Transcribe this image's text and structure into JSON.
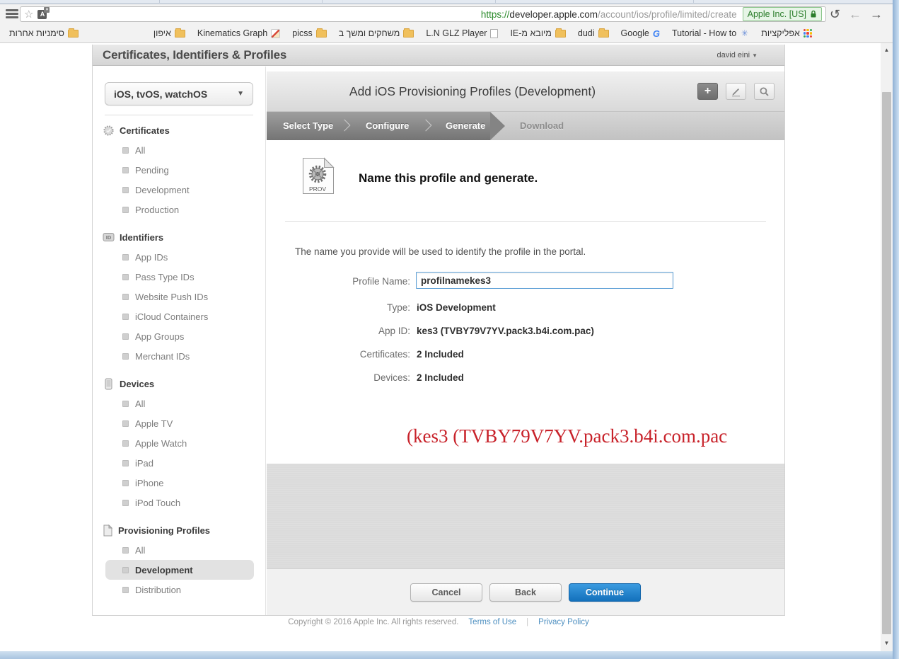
{
  "browser": {
    "toolbar": {
      "url": {
        "scheme": "https://",
        "host": "developer.apple.com",
        "path": "account/ios/profile/limited/create"
      },
      "security_badge": "Apple Inc. [US]"
    },
    "bookmarks_bar": {
      "items": [
        {
          "label": "סימניות אחרות",
          "icon": "folder-icon"
        },
        {
          "label": "איפון",
          "icon": "folder-icon"
        },
        {
          "label": "Kinematics Graph",
          "icon": "kinematics-favicon"
        },
        {
          "label": "picss",
          "icon": "folder-icon"
        },
        {
          "label": "משחקים ומשך ב",
          "icon": "folder-icon"
        },
        {
          "label": "L.N GLZ Player",
          "icon": "page-icon"
        },
        {
          "label": "מיובא מ-IE",
          "icon": "folder-icon"
        },
        {
          "label": "dudi",
          "icon": "folder-icon"
        },
        {
          "label": "Google",
          "icon": "google-favicon"
        },
        {
          "label": "Tutorial - How to",
          "icon": "asterisk-favicon"
        },
        {
          "label": "אפליקציות",
          "icon": "apps-grid-icon"
        }
      ]
    }
  },
  "page": {
    "header": {
      "title": "Certificates, Identifiers & Profiles",
      "user_menu": "david eini"
    },
    "sidebar": {
      "platform_selector": "iOS, tvOS, watchOS",
      "sections": [
        {
          "label": "Certificates",
          "icon": "certificate-seal-icon",
          "items": [
            {
              "label": "All"
            },
            {
              "label": "Pending"
            },
            {
              "label": "Development"
            },
            {
              "label": "Production"
            }
          ]
        },
        {
          "label": "Identifiers",
          "icon": "id-badge-icon",
          "items": [
            {
              "label": "App IDs"
            },
            {
              "label": "Pass Type IDs"
            },
            {
              "label": "Website Push IDs"
            },
            {
              "label": "iCloud Containers"
            },
            {
              "label": "App Groups"
            },
            {
              "label": "Merchant IDs"
            }
          ]
        },
        {
          "label": "Devices",
          "icon": "device-phone-icon",
          "items": [
            {
              "label": "All"
            },
            {
              "label": "Apple TV"
            },
            {
              "label": "Apple Watch"
            },
            {
              "label": "iPad"
            },
            {
              "label": "iPhone"
            },
            {
              "label": "iPod Touch"
            }
          ]
        },
        {
          "label": "Provisioning Profiles",
          "icon": "profile-doc-icon",
          "items": [
            {
              "label": "All"
            },
            {
              "label": "Development"
            },
            {
              "label": "Distribution"
            }
          ],
          "selected": "Development"
        }
      ]
    },
    "wizard": {
      "title": "Add iOS Provisioning Profiles (Development)",
      "steps": [
        {
          "label": "Select Type"
        },
        {
          "label": "Configure"
        },
        {
          "label": "Generate"
        },
        {
          "label": "Download"
        }
      ],
      "active_step": "Generate",
      "file_icon_label": "PROV",
      "heading": "Name this profile and generate.",
      "description": "The name you provide will be used to identify the profile in the portal.",
      "form": {
        "profile_name_label": "Profile Name:",
        "profile_name_value": "profilnamekes3",
        "rows": [
          {
            "label": "Type:",
            "value": "iOS Development"
          },
          {
            "label": "App ID:",
            "value": "kes3 (TVBY79V7YV.pack3.b4i.com.pac)"
          },
          {
            "label": "Certificates:",
            "value": "2 Included"
          },
          {
            "label": "Devices:",
            "value": "2 Included"
          }
        ]
      },
      "annotation": "(kes3 (TVBY79V7YV.pack3.b4i.com.pac",
      "buttons": {
        "cancel": "Cancel",
        "back": "Back",
        "continue": "Continue"
      }
    },
    "footer": {
      "copyright": "Copyright © 2016 Apple Inc. All rights reserved.",
      "links": [
        {
          "label": "Terms of Use"
        },
        {
          "label": "Privacy Policy"
        }
      ]
    }
  },
  "icons": {
    "hamburger-menu-icon": "three horizontal bars",
    "bookmark-star-icon": "☆",
    "translate-icon": "dark square with A",
    "lock-icon": "green padlock",
    "reload-icon": "↺",
    "back-icon": "←",
    "forward-icon": "→",
    "folder-icon": "yellow folder",
    "google-favicon": "G",
    "apps-grid-icon": "3x3 colored grid",
    "asterisk-favicon": "✳",
    "add-icon": "+",
    "edit-icon": "pencil",
    "search-icon": "magnifier",
    "dropdown-arrow-icon": "▾",
    "scroll-up-icon": "▲",
    "scroll-down-icon": "▼"
  },
  "colors": {
    "accent_blue": "#1371bc",
    "ev_green": "#2b7d2b",
    "annotation_red": "#c8222a",
    "selected_item_bg": "#e2e2e2"
  }
}
